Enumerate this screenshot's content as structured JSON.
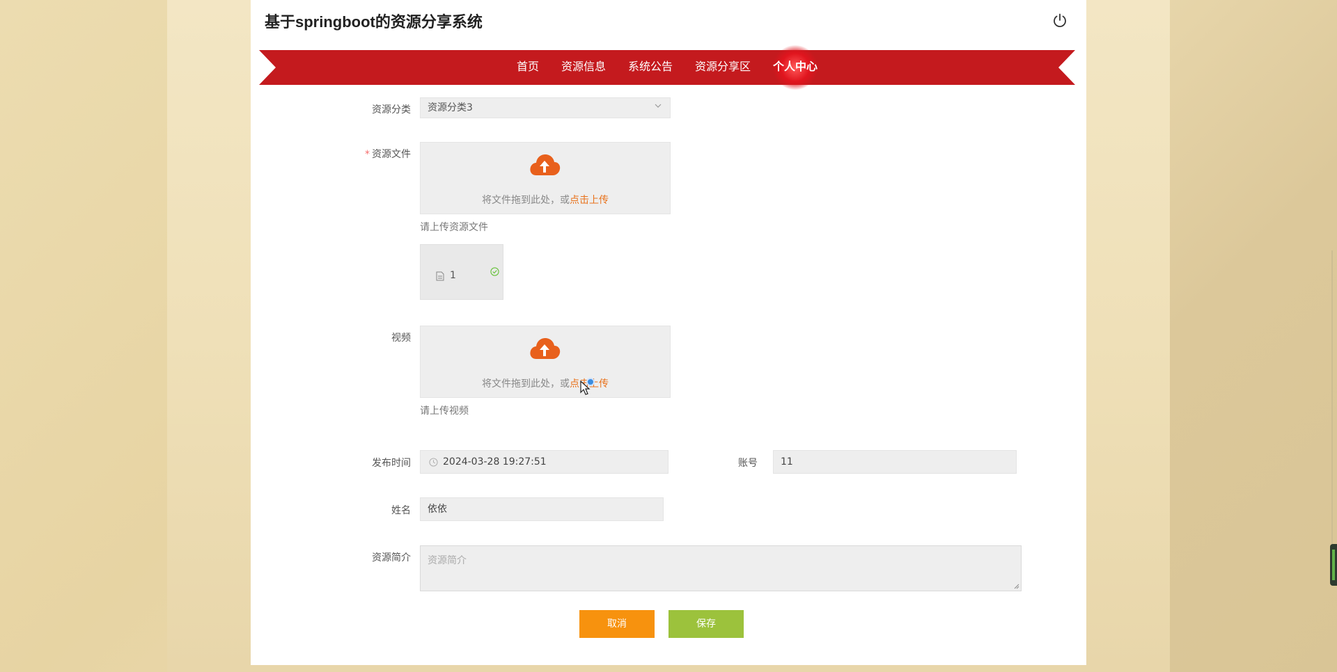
{
  "header": {
    "title": "基于springboot的资源分享系统"
  },
  "nav": {
    "items": [
      "首页",
      "资源信息",
      "系统公告",
      "资源分享区",
      "个人中心"
    ],
    "active_index": 4
  },
  "form": {
    "category": {
      "label": "资源分类",
      "value": "资源分类3"
    },
    "resource_file": {
      "label": "资源文件",
      "required_mark": "*",
      "drop_text": "将文件拖到此处，或",
      "link_text": "点击上传",
      "hint": "请上传资源文件",
      "uploaded_file": "1"
    },
    "video": {
      "label": "视频",
      "drop_text": "将文件拖到此处，或",
      "link_text": "点击上传",
      "hint": "请上传视频"
    },
    "publish_time": {
      "label": "发布时间",
      "value": "2024-03-28 19:27:51"
    },
    "account": {
      "label": "账号",
      "value": "11"
    },
    "name": {
      "label": "姓名",
      "value": "依依"
    },
    "intro": {
      "label": "资源简介",
      "placeholder": "资源简介"
    }
  },
  "buttons": {
    "cancel": "取消",
    "save": "保存"
  },
  "colors": {
    "nav_red": "#c41a1e",
    "upload_orange": "#e8721c",
    "cancel_button": "#f7920e",
    "save_button": "#9cc23c"
  },
  "icons": {
    "power": "power-icon",
    "cloud_upload": "cloud-upload-icon",
    "chevron": "chevron-down-icon",
    "document": "document-icon",
    "check": "check-circle-icon",
    "clock": "clock-icon"
  }
}
